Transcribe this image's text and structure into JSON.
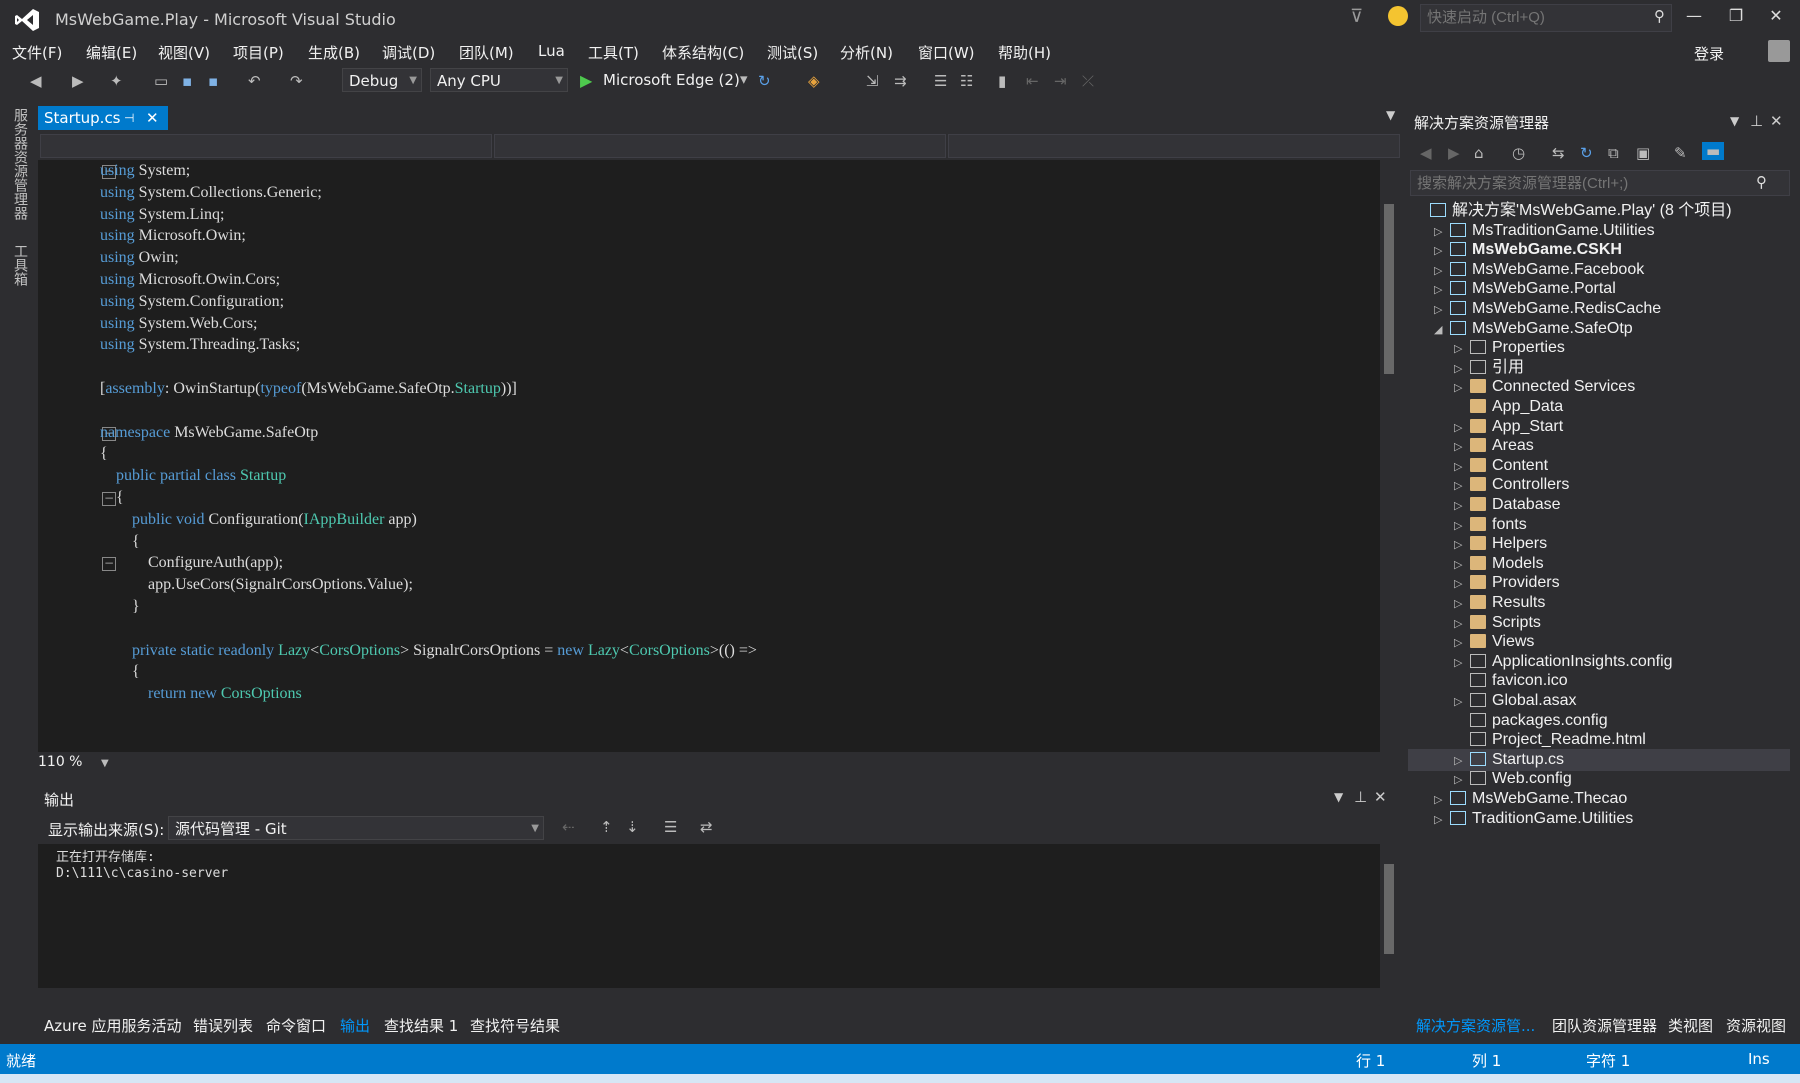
{
  "window": {
    "title": "MsWebGame.Play - Microsoft Visual Studio",
    "quick_launch_placeholder": "快速启动 (Ctrl+Q)",
    "login": "登录"
  },
  "menu": [
    "文件(F)",
    "编辑(E)",
    "视图(V)",
    "项目(P)",
    "生成(B)",
    "调试(D)",
    "团队(M)",
    "Lua",
    "工具(T)",
    "体系结构(C)",
    "测试(S)",
    "分析(N)",
    "窗口(W)",
    "帮助(H)"
  ],
  "toolbar": {
    "config": "Debug",
    "platform": "Any CPU",
    "run_target": "Microsoft Edge (2)"
  },
  "left_strip": {
    "server_explorer": "服务器资源管理器",
    "toolbox": "工具箱"
  },
  "editor": {
    "tab": "Startup.cs",
    "zoom": "110 %"
  },
  "code": [
    "using System;",
    "using System.Collections.Generic;",
    "using System.Linq;",
    "using Microsoft.Owin;",
    "using Owin;",
    "using Microsoft.Owin.Cors;",
    "using System.Configuration;",
    "using System.Web.Cors;",
    "using System.Threading.Tasks;",
    "",
    "[assembly: OwinStartup(typeof(MsWebGame.SafeOtp.Startup))]",
    "",
    "namespace MsWebGame.SafeOtp",
    "{",
    "    public partial class Startup",
    "    {",
    "        public void Configuration(IAppBuilder app)",
    "        {",
    "            ConfigureAuth(app);",
    "            app.UseCors(SignalrCorsOptions.Value);",
    "        }",
    "",
    "        private static readonly Lazy<CorsOptions> SignalrCorsOptions = new Lazy<CorsOptions>(() =>",
    "        {",
    "            return new CorsOptions"
  ],
  "output": {
    "title": "输出",
    "source_label": "显示输出来源(S):",
    "source_value": "源代码管理 - Git",
    "lines": [
      "正在打开存储库:",
      "D:\\111\\c\\casino-server"
    ]
  },
  "bottom_tabs": [
    "Azure 应用服务活动",
    "错误列表",
    "命令窗口",
    "输出",
    "查找结果 1",
    "查找符号结果"
  ],
  "solution_explorer": {
    "title": "解决方案资源管理器",
    "search_placeholder": "搜索解决方案资源管理器(Ctrl+;)",
    "tree": [
      {
        "label": "解决方案'MsWebGame.Play' (8 个项目)",
        "level": 0,
        "icon": "solution",
        "exp": ""
      },
      {
        "label": "MsTraditionGame.Utilities",
        "level": 1,
        "icon": "proj",
        "exp": "▷"
      },
      {
        "label": "MsWebGame.CSKH",
        "level": 1,
        "icon": "proj",
        "exp": "▷",
        "bold": true
      },
      {
        "label": "MsWebGame.Facebook",
        "level": 1,
        "icon": "proj",
        "exp": "▷"
      },
      {
        "label": "MsWebGame.Portal",
        "level": 1,
        "icon": "proj",
        "exp": "▷"
      },
      {
        "label": "MsWebGame.RedisCache",
        "level": 1,
        "icon": "proj",
        "exp": "▷"
      },
      {
        "label": "MsWebGame.SafeOtp",
        "level": 1,
        "icon": "proj",
        "exp": "◢"
      },
      {
        "label": "Properties",
        "level": 2,
        "icon": "wrench",
        "exp": "▷"
      },
      {
        "label": "引用",
        "level": 2,
        "icon": "ref",
        "exp": "▷"
      },
      {
        "label": "Connected Services",
        "level": 2,
        "icon": "folder",
        "exp": "▷"
      },
      {
        "label": "App_Data",
        "level": 2,
        "icon": "folder",
        "exp": ""
      },
      {
        "label": "App_Start",
        "level": 2,
        "icon": "folder",
        "exp": "▷"
      },
      {
        "label": "Areas",
        "level": 2,
        "icon": "folder",
        "exp": "▷"
      },
      {
        "label": "Content",
        "level": 2,
        "icon": "folder",
        "exp": "▷"
      },
      {
        "label": "Controllers",
        "level": 2,
        "icon": "folder",
        "exp": "▷"
      },
      {
        "label": "Database",
        "level": 2,
        "icon": "folder",
        "exp": "▷"
      },
      {
        "label": "fonts",
        "level": 2,
        "icon": "folder",
        "exp": "▷"
      },
      {
        "label": "Helpers",
        "level": 2,
        "icon": "folder",
        "exp": "▷"
      },
      {
        "label": "Models",
        "level": 2,
        "icon": "folder",
        "exp": "▷"
      },
      {
        "label": "Providers",
        "level": 2,
        "icon": "folder",
        "exp": "▷"
      },
      {
        "label": "Results",
        "level": 2,
        "icon": "folder",
        "exp": "▷"
      },
      {
        "label": "Scripts",
        "level": 2,
        "icon": "folder",
        "exp": "▷"
      },
      {
        "label": "Views",
        "level": 2,
        "icon": "folder",
        "exp": "▷"
      },
      {
        "label": "ApplicationInsights.config",
        "level": 2,
        "icon": "file",
        "exp": "▷"
      },
      {
        "label": "favicon.ico",
        "level": 2,
        "icon": "file",
        "exp": ""
      },
      {
        "label": "Global.asax",
        "level": 2,
        "icon": "file",
        "exp": "▷"
      },
      {
        "label": "packages.config",
        "level": 2,
        "icon": "file",
        "exp": ""
      },
      {
        "label": "Project_Readme.html",
        "level": 2,
        "icon": "file",
        "exp": ""
      },
      {
        "label": "Startup.cs",
        "level": 2,
        "icon": "cs",
        "exp": "▷",
        "selected": true
      },
      {
        "label": "Web.config",
        "level": 2,
        "icon": "file",
        "exp": "▷"
      },
      {
        "label": "MsWebGame.Thecao",
        "level": 1,
        "icon": "proj",
        "exp": "▷"
      },
      {
        "label": "TraditionGame.Utilities",
        "level": 1,
        "icon": "proj",
        "exp": "▷"
      }
    ],
    "bottom_tabs": [
      "解决方案资源管...",
      "团队资源管理器",
      "类视图",
      "资源视图"
    ]
  },
  "status": {
    "ready": "就绪",
    "line": "行 1",
    "col": "列 1",
    "char": "字符 1",
    "mode": "Ins"
  },
  "colors": {
    "accent": "#007acc",
    "keyword": "#569cd6",
    "type": "#4ec9b0"
  }
}
